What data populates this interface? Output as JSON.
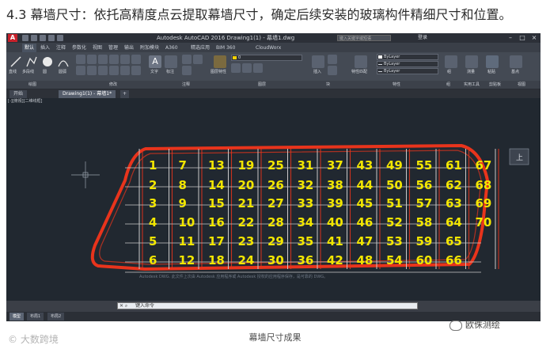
{
  "heading": "4.3 幕墙尺寸：依托高精度点云提取幕墙尺寸，确定后续安装的玻璃构件精细尺寸和位置。",
  "app": {
    "title": "Autodesk AutoCAD 2016    Drawing1(1) - 幕墙1.dwg",
    "search_placeholder": "键入关键字或短语",
    "login": "登录",
    "ribbon_tabs": [
      "默认",
      "插入",
      "注释",
      "参数化",
      "视图",
      "管理",
      "输出",
      "附加模块",
      "A360",
      "精选应用",
      "BIM 360",
      "CloudWorx"
    ],
    "panels": [
      "绘图",
      "修改",
      "注释",
      "图层",
      "块",
      "特性",
      "组",
      "实用工具",
      "剪贴板",
      "视图"
    ],
    "tools": [
      "直线",
      "多段线",
      "圆",
      "圆弧",
      "文字",
      "标注",
      "图层特性",
      "插入",
      "特性匹配",
      "组",
      "测量",
      "粘贴",
      "基点"
    ],
    "layer_combo": "0",
    "bylayer": [
      "ByLayer",
      "ByLayer",
      "ByLayer"
    ],
    "file_tabs": [
      "开始",
      "Drawing1(1) - 幕墙1*"
    ],
    "viewport_label": "[-][俯视][二维线框]",
    "cmd_history": [
      "Autodesk DWG. 此文件上次由 Autodesk 应用程序或 Autodesk 授权的应用程序保存，是可靠的 DWG。"
    ],
    "cmd_prompt": "键入命令",
    "layout_tabs": [
      "模型",
      "布局1",
      "布局2"
    ]
  },
  "drawing": {
    "panel_numbers": [
      [
        "1",
        "2",
        "3",
        "4",
        "5",
        "6"
      ],
      [
        "7",
        "8",
        "9",
        "10",
        "11",
        "12"
      ],
      [
        "13",
        "14",
        "15",
        "16",
        "17",
        "18"
      ],
      [
        "19",
        "20",
        "21",
        "22",
        "23",
        "24"
      ],
      [
        "25",
        "26",
        "27",
        "28",
        "29",
        "30"
      ],
      [
        "31",
        "32",
        "33",
        "34",
        "35",
        "36"
      ],
      [
        "37",
        "38",
        "39",
        "40",
        "41",
        "42"
      ],
      [
        "43",
        "44",
        "45",
        "46",
        "47",
        "48"
      ],
      [
        "49",
        "50",
        "51",
        "52",
        "53",
        "54"
      ],
      [
        "55",
        "56",
        "57",
        "58",
        "59",
        "60"
      ],
      [
        "61",
        "62",
        "63",
        "64",
        "65",
        "66"
      ],
      [
        "67",
        "68",
        "69",
        "70",
        "",
        ""
      ]
    ],
    "colors": {
      "outline": "#e8341c",
      "grid": "#c9c9c9",
      "numbers": "#f2e600",
      "background": "#212830"
    }
  },
  "caption": "幕墙尺寸成果",
  "watermark_left": "大数跨境",
  "watermark_right": "欧侏测绘"
}
